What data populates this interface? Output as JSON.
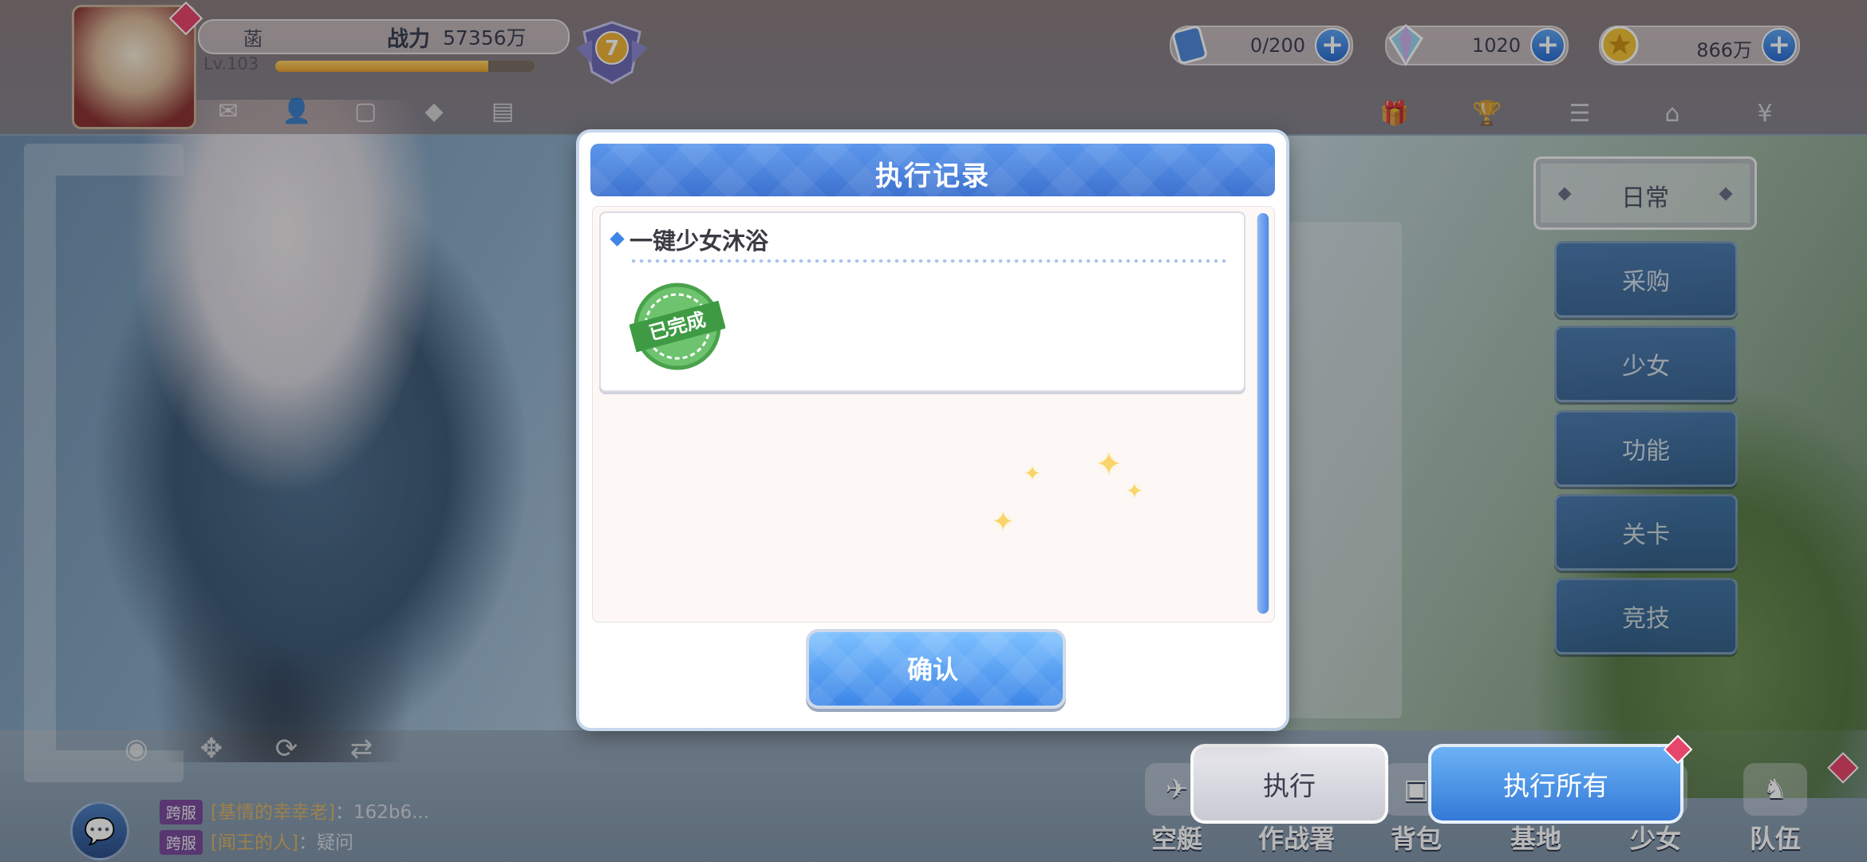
{
  "player": {
    "name": "菡",
    "power_label": "战力",
    "power_value": "57356万",
    "level": "Lv.103",
    "exp_fraction": 0.82,
    "rank": "7"
  },
  "resources": [
    {
      "icon": "stamina-crystal-icon",
      "value": "0/200"
    },
    {
      "icon": "diamond-icon",
      "value": "1020"
    },
    {
      "icon": "gold-coin-icon",
      "value": "866万"
    }
  ],
  "right_panel": {
    "header": "日常",
    "buttons": [
      "采购",
      "少女",
      "功能",
      "关卡",
      "竞技"
    ]
  },
  "modal": {
    "title": "执行记录",
    "records": [
      {
        "title": "一键少女沐浴",
        "stamp": "已完成"
      }
    ],
    "confirm_label": "确认"
  },
  "actions": {
    "execute": "执行",
    "execute_all": "执行所有"
  },
  "chat": [
    {
      "tag": "跨服",
      "name": "[基情的幸幸老]",
      "text": "：162b6..."
    },
    {
      "tag": "跨服",
      "name": "[闻王的人]",
      "text": "：疑问"
    }
  ],
  "bottom_nav": [
    "空艇",
    "作战署",
    "背包",
    "基地",
    "少女",
    "队伍"
  ],
  "colors": {
    "modal_header": "#4a84de",
    "confirm_button": "#4a90ea",
    "stamp_green": "#4caf50",
    "accent_pink": "#e6466b"
  }
}
